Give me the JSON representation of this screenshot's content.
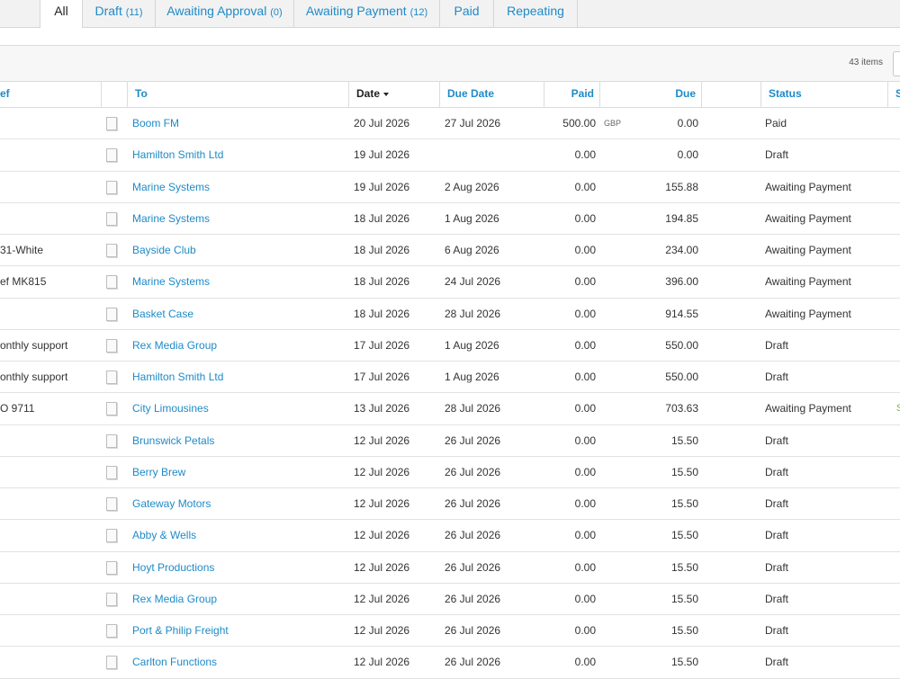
{
  "tabs": [
    {
      "label": "All",
      "count": ""
    },
    {
      "label": "Draft",
      "count": "(11)"
    },
    {
      "label": "Awaiting Approval",
      "count": "(0)"
    },
    {
      "label": "Awaiting Payment",
      "count": "(12)"
    },
    {
      "label": "Paid",
      "count": ""
    },
    {
      "label": "Repeating",
      "count": ""
    }
  ],
  "toolbar": {
    "items_count": "43 items"
  },
  "columns": {
    "ref": "ef",
    "to": "To",
    "date": "Date",
    "due_date": "Due Date",
    "paid": "Paid",
    "due": "Due",
    "status": "Status",
    "extra": "S"
  },
  "rows": [
    {
      "ref": "",
      "to": "Boom FM",
      "date": "20 Jul 2026",
      "due_date": "27 Jul 2026",
      "paid": "500.00",
      "currency": "GBP",
      "due": "0.00",
      "status": "Paid",
      "extra": ""
    },
    {
      "ref": "",
      "to": "Hamilton Smith Ltd",
      "date": "19 Jul 2026",
      "due_date": "",
      "paid": "0.00",
      "currency": "",
      "due": "0.00",
      "status": "Draft",
      "extra": ""
    },
    {
      "ref": "",
      "to": "Marine Systems",
      "date": "19 Jul 2026",
      "due_date": "2 Aug 2026",
      "paid": "0.00",
      "currency": "",
      "due": "155.88",
      "status": "Awaiting Payment",
      "extra": ""
    },
    {
      "ref": "",
      "to": "Marine Systems",
      "date": "18 Jul 2026",
      "due_date": "1 Aug 2026",
      "paid": "0.00",
      "currency": "",
      "due": "194.85",
      "status": "Awaiting Payment",
      "extra": ""
    },
    {
      "ref": "31-White",
      "to": "Bayside Club",
      "date": "18 Jul 2026",
      "due_date": "6 Aug 2026",
      "paid": "0.00",
      "currency": "",
      "due": "234.00",
      "status": "Awaiting Payment",
      "extra": ""
    },
    {
      "ref": "ef MK815",
      "to": "Marine Systems",
      "date": "18 Jul 2026",
      "due_date": "24 Jul 2026",
      "paid": "0.00",
      "currency": "",
      "due": "396.00",
      "status": "Awaiting Payment",
      "extra": ""
    },
    {
      "ref": "",
      "to": "Basket Case",
      "date": "18 Jul 2026",
      "due_date": "28 Jul 2026",
      "paid": "0.00",
      "currency": "",
      "due": "914.55",
      "status": "Awaiting Payment",
      "extra": ""
    },
    {
      "ref": "onthly support",
      "to": "Rex Media Group",
      "date": "17 Jul 2026",
      "due_date": "1 Aug 2026",
      "paid": "0.00",
      "currency": "",
      "due": "550.00",
      "status": "Draft",
      "extra": ""
    },
    {
      "ref": "onthly support",
      "to": "Hamilton Smith Ltd",
      "date": "17 Jul 2026",
      "due_date": "1 Aug 2026",
      "paid": "0.00",
      "currency": "",
      "due": "550.00",
      "status": "Draft",
      "extra": ""
    },
    {
      "ref": "O 9711",
      "to": "City Limousines",
      "date": "13 Jul 2026",
      "due_date": "28 Jul 2026",
      "paid": "0.00",
      "currency": "",
      "due": "703.63",
      "status": "Awaiting Payment",
      "extra": "S"
    },
    {
      "ref": "",
      "to": "Brunswick Petals",
      "date": "12 Jul 2026",
      "due_date": "26 Jul 2026",
      "paid": "0.00",
      "currency": "",
      "due": "15.50",
      "status": "Draft",
      "extra": ""
    },
    {
      "ref": "",
      "to": "Berry Brew",
      "date": "12 Jul 2026",
      "due_date": "26 Jul 2026",
      "paid": "0.00",
      "currency": "",
      "due": "15.50",
      "status": "Draft",
      "extra": ""
    },
    {
      "ref": "",
      "to": "Gateway Motors",
      "date": "12 Jul 2026",
      "due_date": "26 Jul 2026",
      "paid": "0.00",
      "currency": "",
      "due": "15.50",
      "status": "Draft",
      "extra": ""
    },
    {
      "ref": "",
      "to": "Abby & Wells",
      "date": "12 Jul 2026",
      "due_date": "26 Jul 2026",
      "paid": "0.00",
      "currency": "",
      "due": "15.50",
      "status": "Draft",
      "extra": ""
    },
    {
      "ref": "",
      "to": "Hoyt Productions",
      "date": "12 Jul 2026",
      "due_date": "26 Jul 2026",
      "paid": "0.00",
      "currency": "",
      "due": "15.50",
      "status": "Draft",
      "extra": ""
    },
    {
      "ref": "",
      "to": "Rex Media Group",
      "date": "12 Jul 2026",
      "due_date": "26 Jul 2026",
      "paid": "0.00",
      "currency": "",
      "due": "15.50",
      "status": "Draft",
      "extra": ""
    },
    {
      "ref": "",
      "to": "Port & Philip Freight",
      "date": "12 Jul 2026",
      "due_date": "26 Jul 2026",
      "paid": "0.00",
      "currency": "",
      "due": "15.50",
      "status": "Draft",
      "extra": ""
    },
    {
      "ref": "",
      "to": "Carlton Functions",
      "date": "12 Jul 2026",
      "due_date": "26 Jul 2026",
      "paid": "0.00",
      "currency": "",
      "due": "15.50",
      "status": "Draft",
      "extra": ""
    }
  ]
}
